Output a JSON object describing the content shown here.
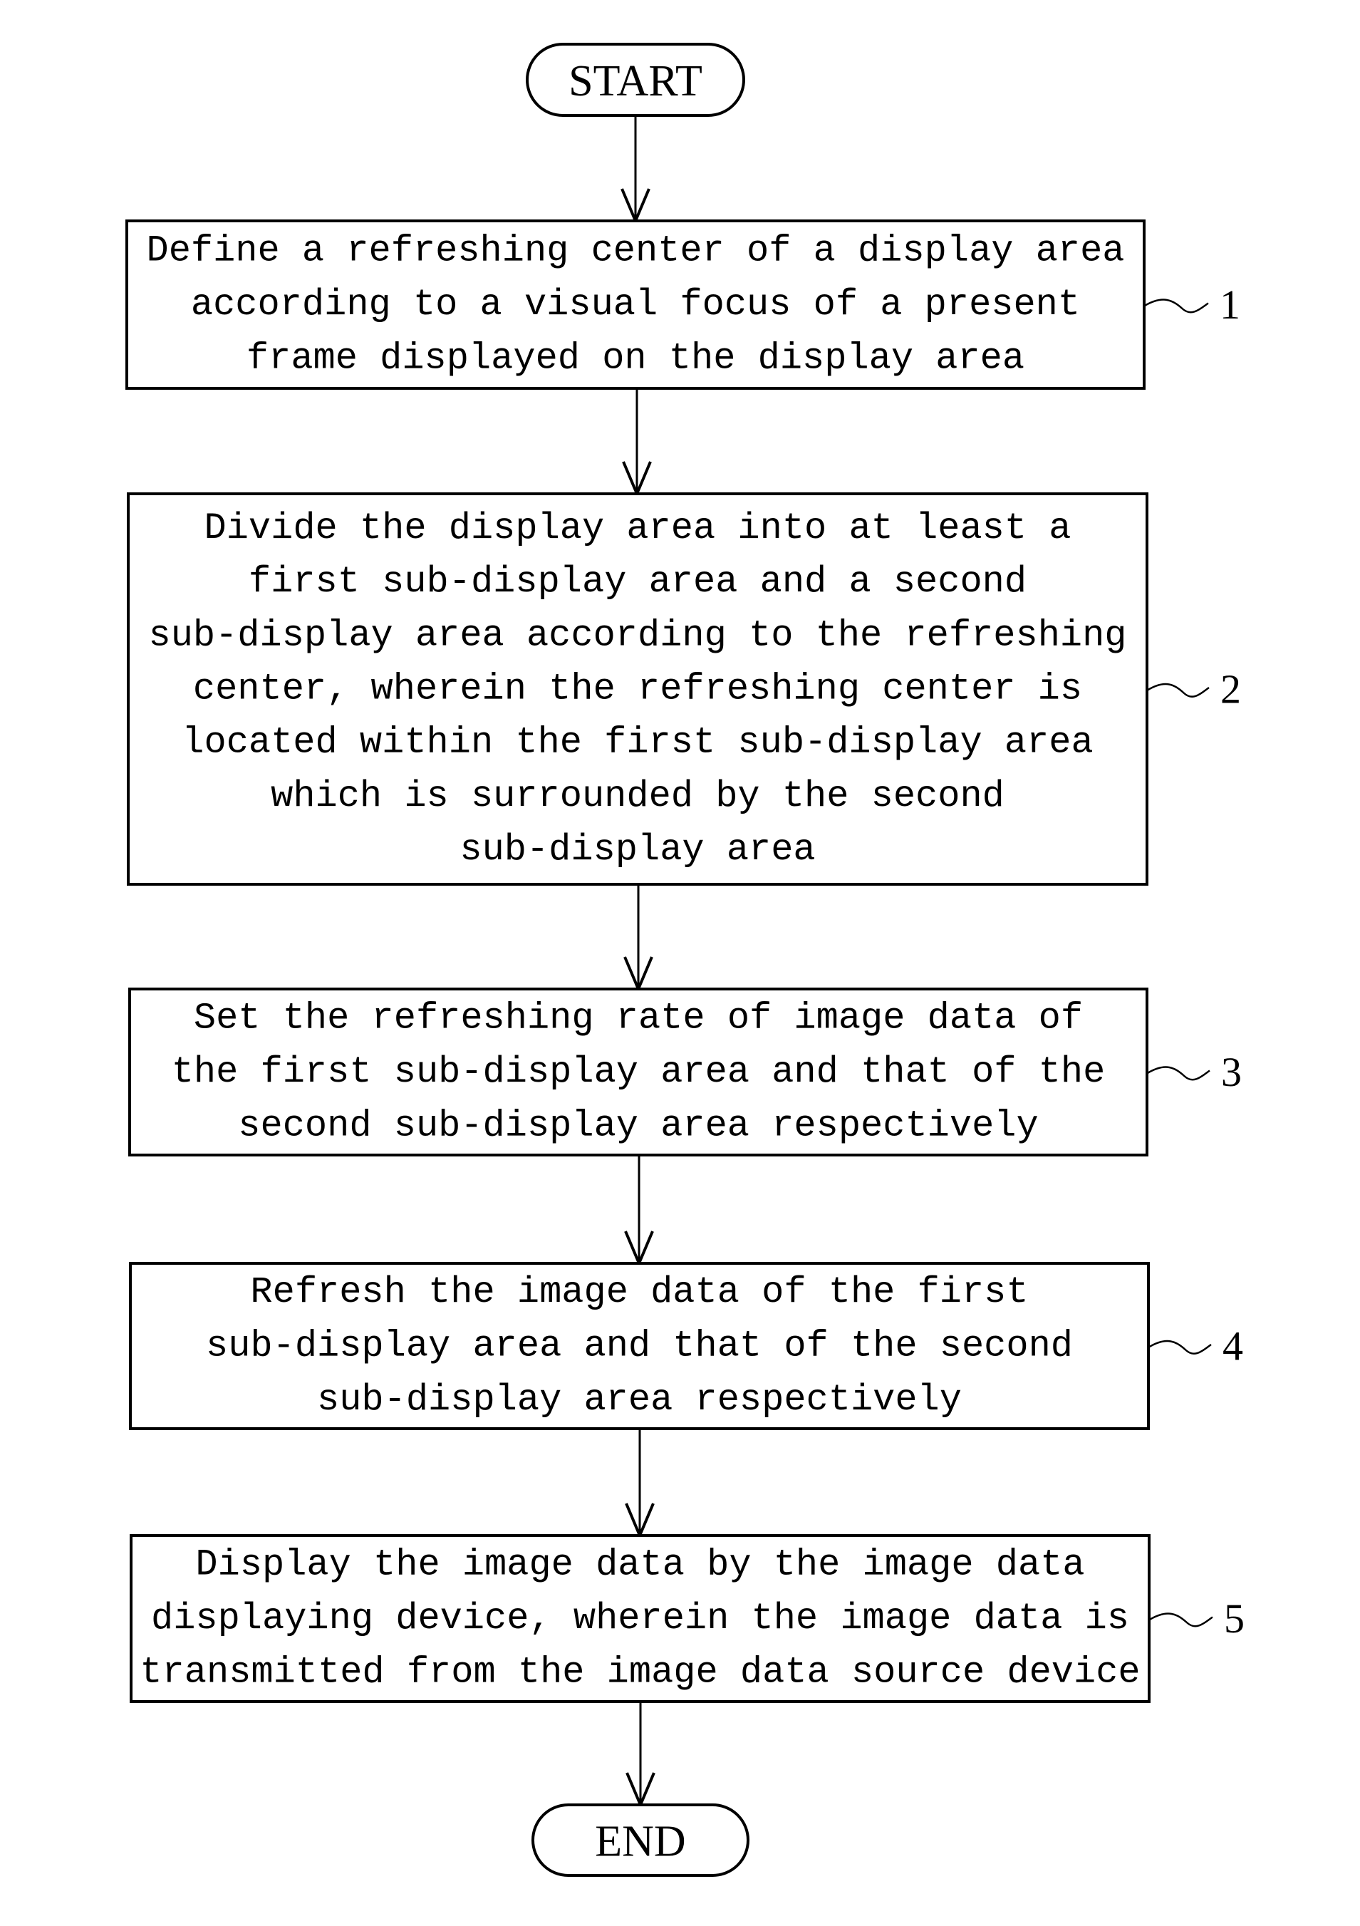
{
  "diagram": {
    "type": "flowchart",
    "start": {
      "label": "START"
    },
    "end": {
      "label": "END"
    },
    "steps": [
      {
        "ref": "1",
        "lines": [
          "Define a refreshing center of a display area",
          "according to a visual focus of a present",
          "frame displayed on the display area"
        ]
      },
      {
        "ref": "2",
        "lines": [
          "Divide the display area into at least a",
          "first sub-display area and a second",
          "sub-display area according to the refreshing",
          "center, wherein the refreshing center is",
          "located within the first sub-display area",
          "which is surrounded by the second",
          "sub-display area"
        ]
      },
      {
        "ref": "3",
        "lines": [
          "Set the refreshing rate of image data of",
          "the first sub-display area and that of the",
          "second sub-display area respectively"
        ]
      },
      {
        "ref": "4",
        "lines": [
          "Refresh the image data of the first",
          "sub-display area and that of the second",
          "sub-display area respectively"
        ]
      },
      {
        "ref": "5",
        "lines": [
          "Display the image data by the image data",
          "displaying device, wherein the image data is",
          "transmitted from the image data source device"
        ]
      }
    ],
    "flow": [
      "START",
      "1",
      "2",
      "3",
      "4",
      "5",
      "END"
    ]
  }
}
